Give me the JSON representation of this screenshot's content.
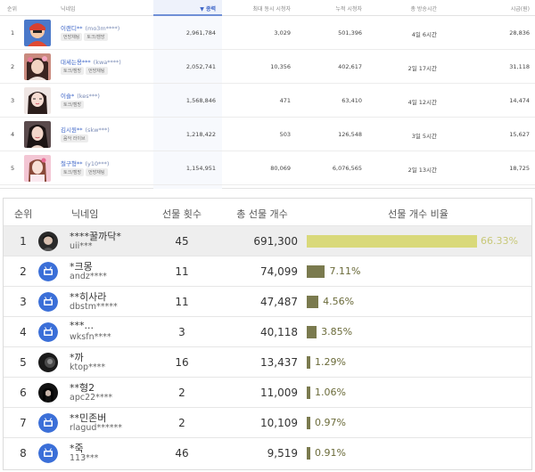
{
  "top_ranking": {
    "columns": {
      "rank": "순위",
      "nickname": "닉네임",
      "power": "▼ 종력",
      "max_concurrent": "최대 동시 시청자",
      "cumulative_viewers": "누적 시청자",
      "total_broadcast_time": "총 방송시간",
      "salary": "시급(원)"
    },
    "rows": [
      {
        "rank": "1",
        "nickname": "이랜디**",
        "uid": "(mo3m****)",
        "tags": [
          "먼방채팅",
          "토크/캠방"
        ],
        "power": "2,961,784",
        "max_concurrent": "3,029",
        "cumulative": "501,396",
        "time": "4일 6시간",
        "salary": "28,836"
      },
      {
        "rank": "2",
        "nickname": "대세는용***",
        "uid": "(kwa****)",
        "tags": [
          "토크/캠방",
          "먼방채팅"
        ],
        "power": "2,052,741",
        "max_concurrent": "10,356",
        "cumulative": "402,617",
        "time": "2일 17시간",
        "salary": "31,118"
      },
      {
        "rank": "3",
        "nickname": "이슬*",
        "uid": "(kes***)",
        "tags": [
          "토크/캠방"
        ],
        "power": "1,568,846",
        "max_concurrent": "471",
        "cumulative": "63,410",
        "time": "4일 12시간",
        "salary": "14,474"
      },
      {
        "rank": "4",
        "nickname": "김시원**",
        "uid": "(skw***)",
        "tags": [
          "음악 라이브"
        ],
        "power": "1,218,422",
        "max_concurrent": "503",
        "cumulative": "126,548",
        "time": "3일 5시간",
        "salary": "15,627"
      },
      {
        "rank": "5",
        "nickname": "철구형**",
        "uid": "(y10***)",
        "tags": [
          "토크/캠방",
          "먼방채팅"
        ],
        "power": "1,154,951",
        "max_concurrent": "80,069",
        "cumulative": "6,076,565",
        "time": "2일 13시간",
        "salary": "18,725"
      }
    ]
  },
  "gift_ranking": {
    "columns": {
      "rank": "순위",
      "nickname": "닉네임",
      "gift_count": "선물 횟수",
      "total_gifts": "총 선물 개수",
      "ratio": "선물 개수 비율"
    },
    "rows": [
      {
        "rank": "1",
        "nickname": "****꿀까닥*",
        "id": "uii***",
        "gift_count": "45",
        "total": "691,300",
        "ratio_label": "66.33%",
        "ratio": 66.33
      },
      {
        "rank": "2",
        "nickname": "*크몽",
        "id": "andz****",
        "gift_count": "11",
        "total": "74,099",
        "ratio_label": "7.11%",
        "ratio": 7.11
      },
      {
        "rank": "3",
        "nickname": "**히사라",
        "id": "dbstm*****",
        "gift_count": "11",
        "total": "47,487",
        "ratio_label": "4.56%",
        "ratio": 4.56
      },
      {
        "rank": "4",
        "nickname": "***...",
        "id": "wksfn****",
        "gift_count": "3",
        "total": "40,118",
        "ratio_label": "3.85%",
        "ratio": 3.85
      },
      {
        "rank": "5",
        "nickname": "*까",
        "id": "ktop****",
        "gift_count": "16",
        "total": "13,437",
        "ratio_label": "1.29%",
        "ratio": 1.29
      },
      {
        "rank": "6",
        "nickname": "**형2",
        "id": "apc22****",
        "gift_count": "2",
        "total": "11,009",
        "ratio_label": "1.06%",
        "ratio": 1.06
      },
      {
        "rank": "7",
        "nickname": "**민존버",
        "id": "rlagud******",
        "gift_count": "2",
        "total": "10,109",
        "ratio_label": "0.97%",
        "ratio": 0.97
      },
      {
        "rank": "8",
        "nickname": "*죽",
        "id": "113***",
        "gift_count": "46",
        "total": "9,519",
        "ratio_label": "0.91%",
        "ratio": 0.91
      }
    ],
    "colors": {
      "first_bar": "#d9d97a",
      "bar": "#7a7a4e",
      "highlight_row": "#eeeeee"
    }
  }
}
